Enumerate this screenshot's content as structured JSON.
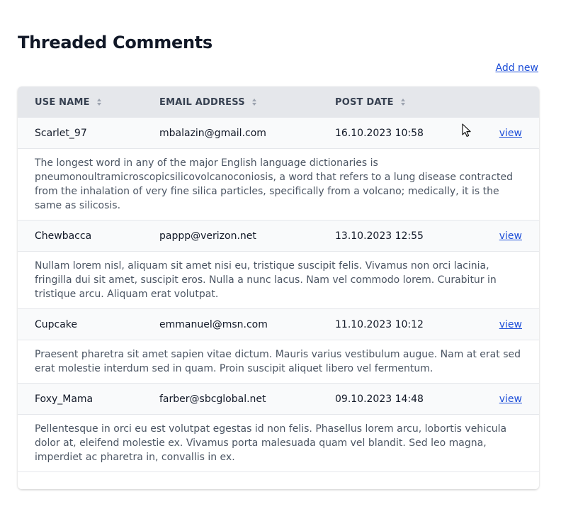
{
  "page": {
    "title": "Threaded Comments",
    "add_new_label": "Add new"
  },
  "table": {
    "headers": {
      "name": "USE NAME",
      "email": "EMAIL ADDRESS",
      "date": "POST DATE"
    },
    "view_label": "view",
    "rows": [
      {
        "name": "Scarlet_97",
        "email": "mbalazin@gmail.com",
        "date": "16.10.2023 10:58",
        "comment": "The longest word in any of the major English language dictionaries is pneumonoultramicroscopicsilicovolcanoconiosis, a word that refers to a lung disease contracted from the inhalation of very fine silica particles, specifically from a volcano; medically, it is the same as silicosis."
      },
      {
        "name": "Chewbacca",
        "email": "pappp@verizon.net",
        "date": "13.10.2023 12:55",
        "comment": "Nullam lorem nisl, aliquam sit amet nisi eu, tristique suscipit felis. Vivamus non orci lacinia, fringilla dui sit amet, suscipit eros. Nulla a nunc lacus. Nam vel commodo lorem. Curabitur in tristique arcu. Aliquam erat volutpat."
      },
      {
        "name": "Cupcake",
        "email": "emmanuel@msn.com",
        "date": "11.10.2023 10:12",
        "comment": "Praesent pharetra sit amet sapien vitae dictum. Mauris varius vestibulum augue. Nam at erat sed erat molestie interdum sed in quam. Proin suscipit aliquet libero vel fermentum."
      },
      {
        "name": "Foxy_Mama",
        "email": "farber@sbcglobal.net",
        "date": "09.10.2023 14:48",
        "comment": "Pellentesque in orci eu est volutpat egestas id non felis. Phasellus lorem arcu, lobortis vehicula dolor at, eleifend molestie ex. Vivamus porta malesuada quam vel blandit. Sed leo magna, imperdiet ac pharetra in, convallis in ex."
      }
    ]
  },
  "colors": {
    "link": "#1d4ed8",
    "header_bg": "#e5e7eb",
    "row_bg": "#f9fafb",
    "comment_text": "#4b5563"
  },
  "icons": {
    "sort": "sort-icon",
    "cursor": "mouse-pointer-icon"
  }
}
